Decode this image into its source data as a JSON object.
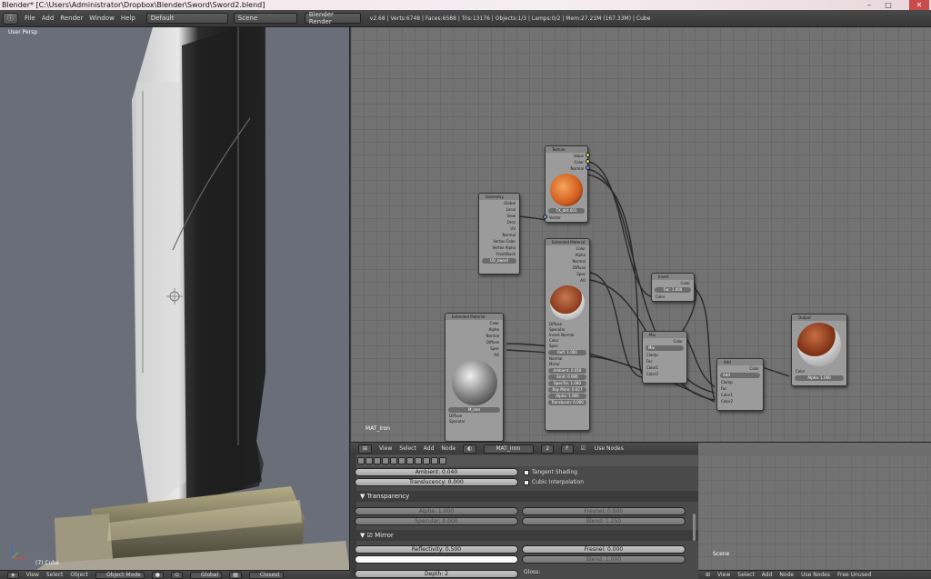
{
  "window": {
    "title": "Blender* [C:\\Users\\Administrator\\Dropbox\\Blender\\Sword\\Sword2.blend]"
  },
  "topbar": {
    "menu": [
      "File",
      "Add",
      "Render",
      "Window",
      "Help"
    ],
    "screen_layout": "Default",
    "scene": "Scene",
    "render_engine": "Blender Render",
    "stats": "v2.68 | Verts:6748 | Faces:6588 | Tris:13176 | Objects:1/3 | Lamps:0/2 | Mem:27.21M (167.33M) | Cube"
  },
  "viewport": {
    "label": "User Persp",
    "object_label": "(7) Cube",
    "header": {
      "view": "View",
      "select": "Select",
      "object": "Object",
      "mode": "Object Mode",
      "pivot": "Global",
      "snap": "Closest"
    }
  },
  "node_editor": {
    "material_label": "MAT_iron",
    "toolbar": {
      "view": "View",
      "select": "Select",
      "add": "Add",
      "node": "Node",
      "material": "MAT_iron",
      "users": "2",
      "fake": "F",
      "use_nodes": "Use Nodes"
    },
    "nodes": {
      "texture": {
        "title": "Texture",
        "outputs": [
          "Value",
          "Color",
          "Normal"
        ],
        "tex_name": "TX_dirt.001",
        "input": "Vector"
      },
      "geometry": {
        "title": "Geometry",
        "outputs": [
          "Global",
          "Local",
          "View",
          "Orco",
          "UV",
          "Normal",
          "Vertex Color",
          "Vertex Alpha",
          "Front/Back"
        ],
        "uv": "UV_sword"
      },
      "ext_material_center": {
        "title": "Extended Material",
        "outputs": [
          "Color",
          "Alpha",
          "Normal",
          "Diffuse",
          "Spec",
          "AO"
        ],
        "checks": [
          "Diffuse",
          "Specular",
          "Invert Normal"
        ],
        "inputs": [
          "Color",
          "Spec",
          "Refl: 1.000",
          "Normal",
          "Mirror",
          "Ambient: 0.050",
          "Emit: 0.000",
          "SpecTra: 1.000",
          "Ray Mirro: 0.027",
          "Alpha: 1.000",
          "Translucen: 0.000"
        ]
      },
      "ext_material_left": {
        "title": "Extended Material",
        "outputs": [
          "Color",
          "Alpha",
          "Normal",
          "Diffuse",
          "Spec",
          "AO"
        ],
        "mat_name": "M_iron",
        "users": "2",
        "checks": [
          "Diffuse",
          "Specular"
        ]
      },
      "invert": {
        "title": "Invert",
        "output": "Color",
        "fac": "Fac: 1.000",
        "input": "Color"
      },
      "mix": {
        "title": "Mix",
        "output": "Color",
        "mode": "Mix",
        "clamp": "Clamp",
        "inputs": [
          "Fac",
          "Color1",
          "Color2"
        ]
      },
      "add": {
        "title": "Add",
        "output": "Color",
        "mode": "Add",
        "clamp": "Clamp",
        "inputs": [
          "Fac",
          "Color1",
          "Color2"
        ]
      },
      "output": {
        "title": "Output",
        "input": "Color",
        "alpha": "Alpha: 1.000"
      }
    }
  },
  "properties": {
    "ambient": "Ambient: 0.040",
    "translucency": "Translucency: 0.000",
    "tangent_shading": "Tangent Shading",
    "cubic_interp": "Cubic Interpolation",
    "transparency_header": "Transparency",
    "alpha": "Alpha: 1.000",
    "fresnel_t": "Fresnel: 0.000",
    "specular": "Specular: 0.000",
    "blend_t": "Blend: 1.250",
    "mirror_header": "Mirror",
    "reflectivity": "Reflectivity: 0.500",
    "fresnel_m": "Fresnel: 0.000",
    "blend_m": "Blend: 1.000",
    "depth": "Depth: 2",
    "gloss": "Gloss:"
  },
  "right_panel": {
    "scene_label": "Scene",
    "header": {
      "view": "View",
      "select": "Select",
      "add": "Add",
      "node": "Node",
      "use_nodes": "Use Nodes",
      "free_unused": "Free Unused"
    }
  }
}
